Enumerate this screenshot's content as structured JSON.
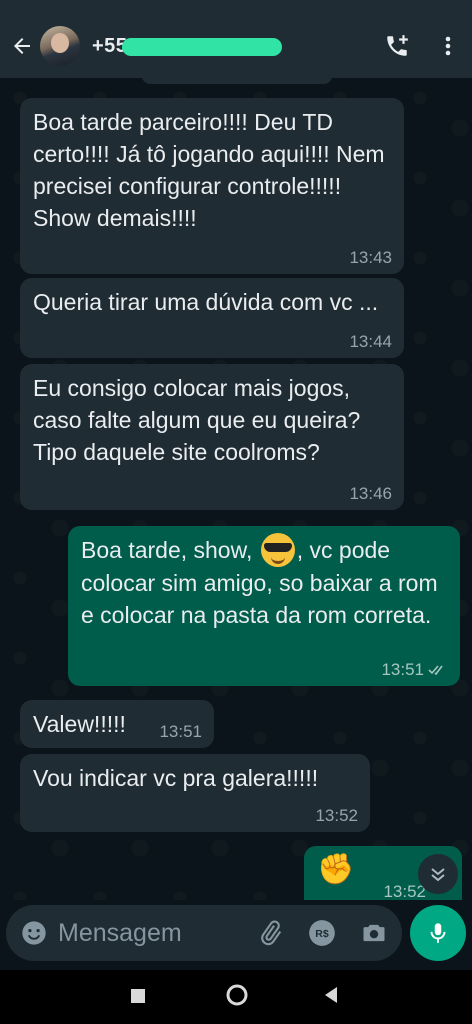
{
  "header": {
    "contact_name": "+55 11 98525-0265",
    "icons": [
      "back-arrow-icon",
      "avatar",
      "add-call-icon",
      "more-vert-icon"
    ]
  },
  "messages": [
    {
      "direction": "in",
      "text": "Boa tarde parceiro!!!! Deu TD certo!!!! Já tô jogando aqui!!!! Nem precisei configurar controle!!!!! Show demais!!!!",
      "time": "13:43"
    },
    {
      "direction": "in",
      "text": "Queria tirar uma dúvida com vc ...",
      "time": "13:44"
    },
    {
      "direction": "in",
      "text": "Eu consigo colocar mais jogos, caso falte algum que eu queira? Tipo daquele site coolroms?",
      "time": "13:46"
    },
    {
      "direction": "out",
      "text_before_emoji": "Boa tarde, show,",
      "emoji": "smiling-face-with-sunglasses",
      "text_after_emoji": ", vc pode colocar sim amigo, so baixar a rom e colocar na pasta da rom correta.",
      "time": "13:51",
      "status": "read"
    },
    {
      "direction": "in",
      "text": "Valew!!!!!",
      "time": "13:51"
    },
    {
      "direction": "in",
      "text": "Vou indicar vc pra galera!!!!!",
      "time": "13:52"
    },
    {
      "direction": "out",
      "emoji": "oncoming-fist",
      "time": "13:52"
    }
  ],
  "composer": {
    "placeholder": "Mensagem",
    "icons": [
      "emoji-icon",
      "attach-icon",
      "payment-icon",
      "camera-icon",
      "mic-icon"
    ]
  },
  "colors": {
    "background": "#0b141a",
    "bar": "#1f2c34",
    "incoming_bubble": "#202c33",
    "outgoing_bubble": "#005c4b",
    "accent": "#00a884"
  }
}
